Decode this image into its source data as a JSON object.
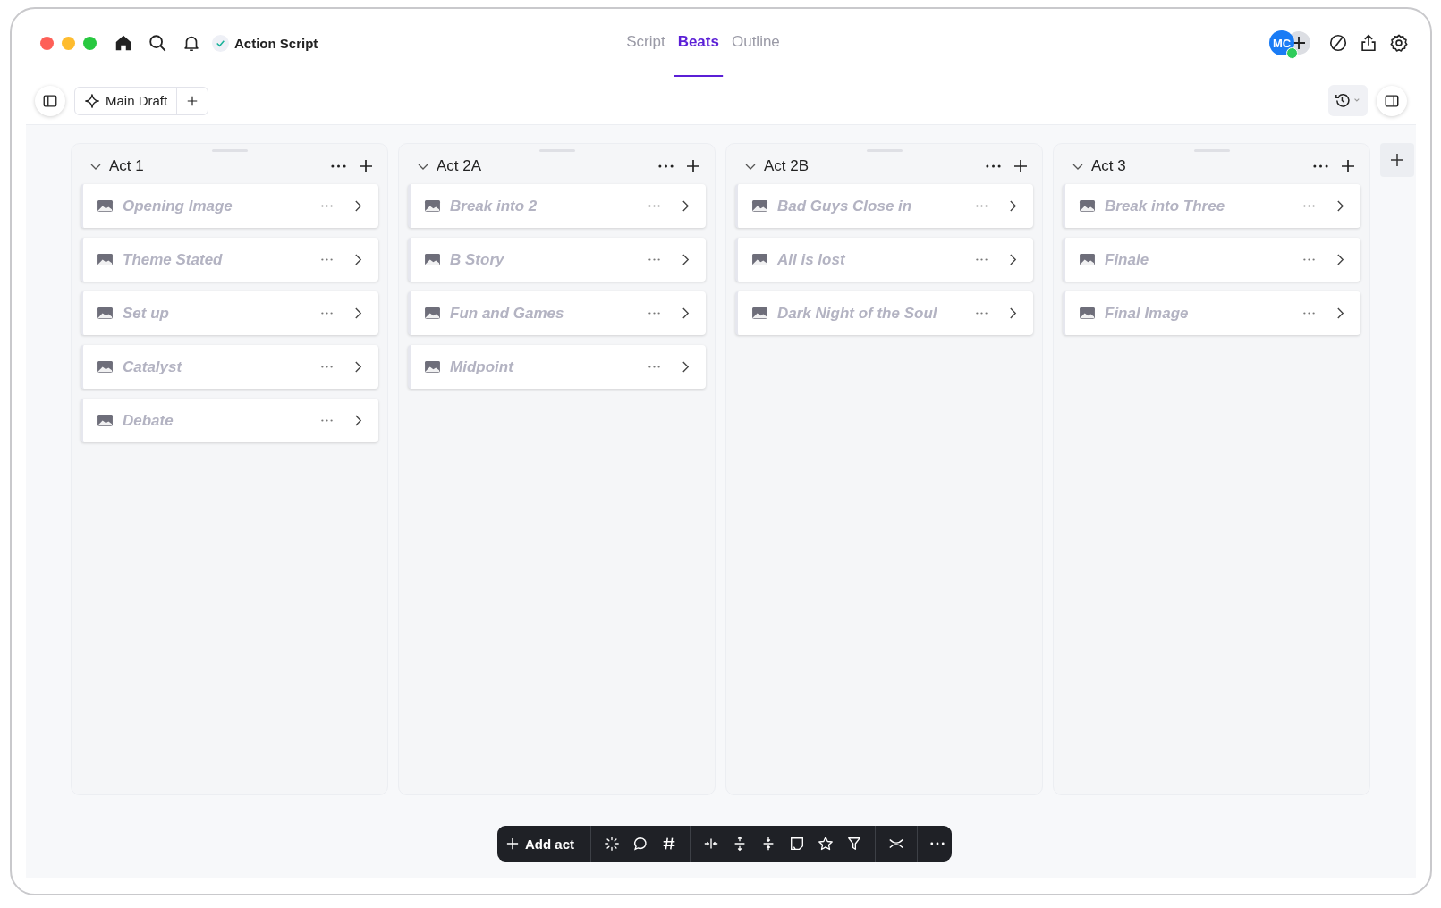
{
  "document": {
    "title": "Action Script",
    "saved": true
  },
  "tabs": [
    {
      "label": "Script",
      "selected": false
    },
    {
      "label": "Beats",
      "selected": true
    },
    {
      "label": "Outline",
      "selected": false
    }
  ],
  "avatar": {
    "initials": "MC",
    "online": true
  },
  "draft": {
    "label": "Main Draft"
  },
  "acts": [
    {
      "title": "Act 1",
      "expanded": true,
      "beats": [
        "Opening Image",
        "Theme Stated",
        "Set up",
        "Catalyst",
        "Debate"
      ]
    },
    {
      "title": "Act 2A",
      "expanded": true,
      "beats": [
        "Break into 2",
        "B Story",
        "Fun and Games",
        "Midpoint"
      ]
    },
    {
      "title": "Act 2B",
      "expanded": true,
      "beats": [
        "Bad Guys Close in",
        "All is lost",
        "Dark Night of the Soul"
      ]
    },
    {
      "title": "Act 3",
      "expanded": true,
      "beats": [
        "Break into Three",
        "Finale",
        "Final Image"
      ]
    }
  ],
  "toolbar": {
    "add_label": "Add act"
  }
}
